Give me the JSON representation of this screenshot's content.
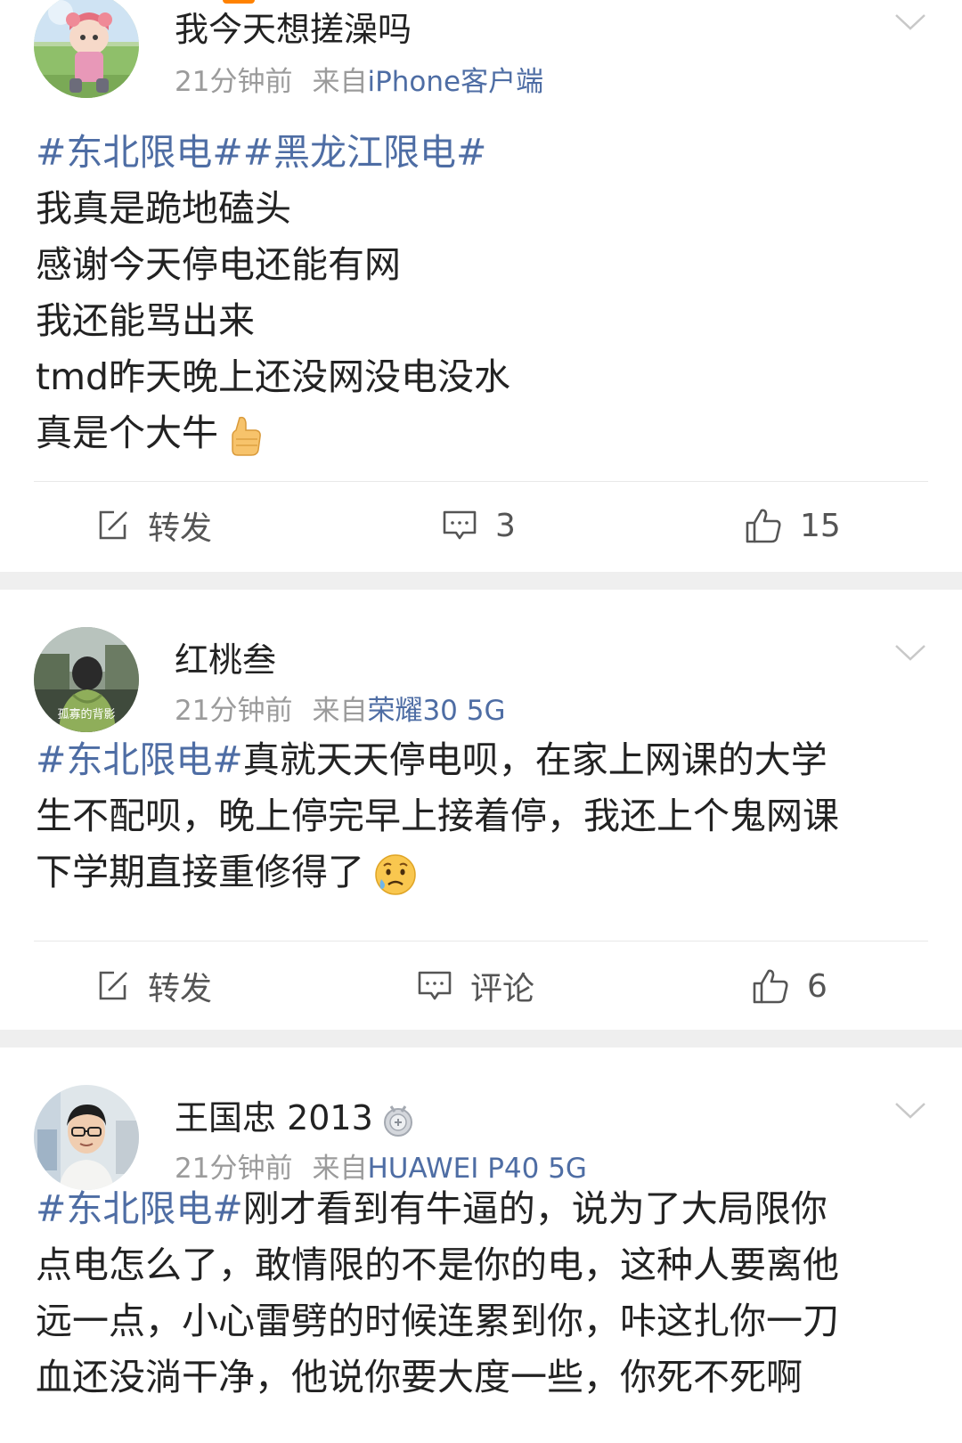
{
  "colors": {
    "link": "#4e6da4",
    "meta": "#9b9b9b",
    "text": "#222222",
    "separator": "#efefef",
    "accent": "#ff8200"
  },
  "labels": {
    "from": "来自"
  },
  "posts": [
    {
      "username": "我今天想搓澡吗",
      "time": "21分钟前",
      "source": "iPhone客户端",
      "text_lines": [
        {
          "tag": "#东北限电##黑龙江限电#",
          "text": ""
        },
        {
          "tag": "",
          "text": "我真是跪地磕头"
        },
        {
          "tag": "",
          "text": "感谢今天停电还能有网"
        },
        {
          "tag": "",
          "text": "我还能骂出来"
        },
        {
          "tag": "",
          "text": "tmd昨天晚上还没网没电没水"
        },
        {
          "tag": "",
          "text": "真是个大牛",
          "emoji": "thumbs-up"
        }
      ],
      "actions": {
        "repost": "转发",
        "comment": "3",
        "like": "15"
      }
    },
    {
      "username": "红桃叁",
      "avatar_caption": "孤寡的背影",
      "time": "21分钟前",
      "source": "荣耀30 5G",
      "text_lines": [
        {
          "tag": "#东北限电#",
          "text": "真就天天停电呗，在家上网课的大学"
        },
        {
          "tag": "",
          "text": "生不配呗，晚上停完早上接着停，我还上个鬼网课"
        },
        {
          "tag": "",
          "text": "下学期直接重修得了",
          "emoji": "sad-sweat-face"
        }
      ],
      "actions": {
        "repost": "转发",
        "comment": "评论",
        "like": "6"
      }
    },
    {
      "username": "王国忠 2013",
      "badge": "medal",
      "time": "21分钟前",
      "source": "HUAWEI P40 5G",
      "text_lines": [
        {
          "tag": "#东北限电#",
          "text": "刚才看到有牛逼的，说为了大局限你"
        },
        {
          "tag": "",
          "text": "点电怎么了，敢情限的不是你的电，这种人要离他"
        },
        {
          "tag": "",
          "text": "远一点，小心雷劈的时候连累到你，咔这扎你一刀"
        },
        {
          "tag": "",
          "text": "血还没淌干净，他说你要大度一些，你死不死啊"
        }
      ]
    }
  ]
}
